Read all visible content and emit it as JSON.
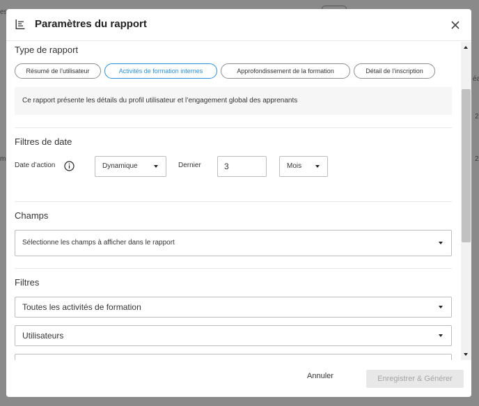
{
  "background": {
    "fragments": [
      "es",
      "éa",
      "2",
      "m",
      "2"
    ]
  },
  "modal": {
    "title": "Paramètres du rapport",
    "header_icon": "report-settings-icon",
    "close_icon": "close-icon"
  },
  "report_type": {
    "title": "Type de rapport",
    "options": [
      {
        "label": "Résumé de l’utilisateur",
        "active": false
      },
      {
        "label": "Activités de formation internes",
        "active": true
      },
      {
        "label": "Approfondissement de la formation",
        "active": false
      },
      {
        "label": "Détail de l’inscription",
        "active": false
      }
    ],
    "description": "Ce rapport présente les détails du profil utilisateur et l’engagement global des apprenants"
  },
  "date_filters": {
    "title": "Filtres de date",
    "action_date_label": "Date d’action",
    "mode_value": "Dynamique",
    "last_label": "Dernier",
    "last_value": "3",
    "unit_value": "Mois"
  },
  "fields": {
    "title": "Champs",
    "placeholder": "Sélectionne les champs à afficher dans le rapport"
  },
  "filters": {
    "title": "Filtres",
    "activities_value": "Toutes les activités de formation",
    "users_value": "Utilisateurs"
  },
  "footer": {
    "cancel_label": "Annuler",
    "save_label": "Enregistrer & Générer"
  },
  "colors": {
    "accent": "#2a8fd6",
    "overlay": "#8a8a8a",
    "disabled_bg": "#e8e8e8",
    "disabled_text": "#a5a5a5"
  }
}
